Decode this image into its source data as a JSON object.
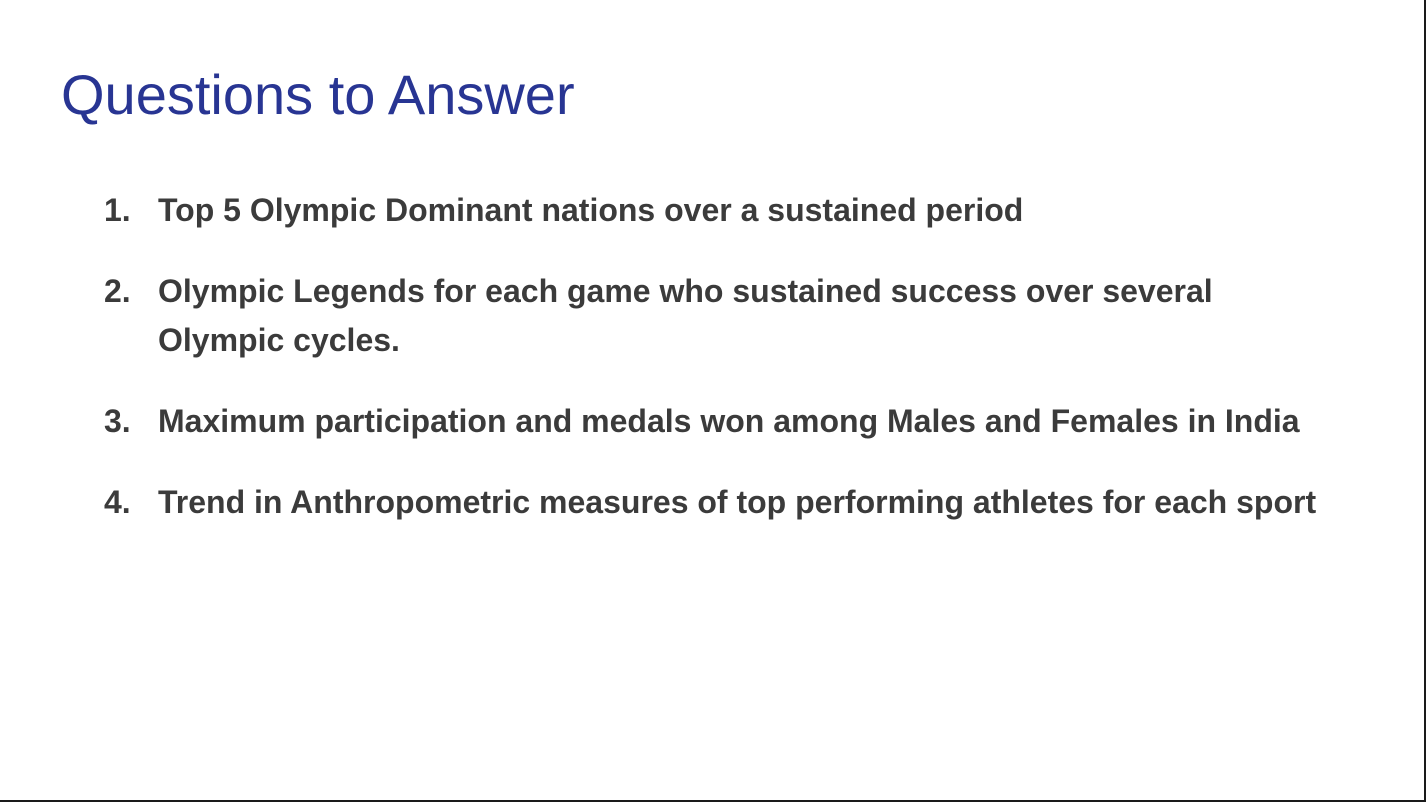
{
  "slide": {
    "title": "Questions to Answer",
    "title_color": "#283593",
    "text_color": "#3b3b3b",
    "questions": [
      {
        "number": "1.",
        "text": "Top 5 Olympic Dominant nations over a sustained period"
      },
      {
        "number": "2.",
        "text": "Olympic Legends for each game who sustained success over several Olympic cycles."
      },
      {
        "number": "3.",
        "text": "Maximum participation and medals won among Males and Females in India"
      },
      {
        "number": "4.",
        "text": "Trend in Anthropometric measures of top performing athletes for each sport"
      }
    ]
  }
}
